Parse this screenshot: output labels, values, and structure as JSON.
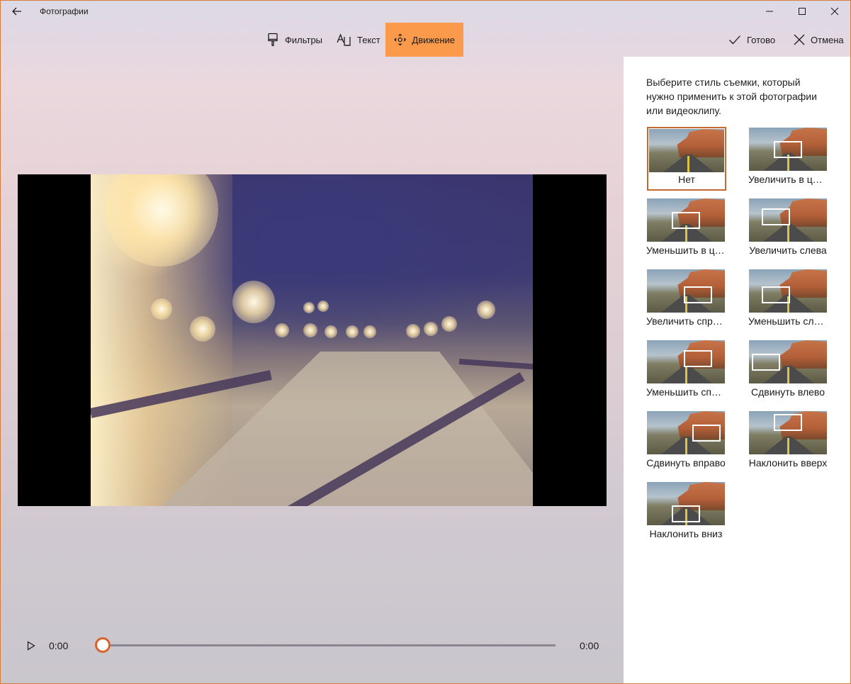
{
  "window": {
    "title": "Фотографии",
    "accent": "#d97a3a"
  },
  "toolbar": {
    "filters_label": "Фильтры",
    "text_label": "Текст",
    "motion_label": "Движение",
    "done_label": "Готово",
    "cancel_label": "Отмена",
    "active_color": "#fb9a4a"
  },
  "playback": {
    "current_time": "0:00",
    "total_time": "0:00",
    "progress": 0
  },
  "panel": {
    "description": "Выберите стиль съемки, который нужно применить к этой фотографии или видеоклипу.",
    "styles": [
      {
        "label": "Нет",
        "selected": true
      },
      {
        "label": "Увеличить в центре"
      },
      {
        "label": "Уменьшить в центре"
      },
      {
        "label": "Увеличить слева"
      },
      {
        "label": "Увеличить справа"
      },
      {
        "label": "Уменьшить слева"
      },
      {
        "label": "Уменьшить справа"
      },
      {
        "label": "Сдвинуть влево"
      },
      {
        "label": "Сдвинуть вправо"
      },
      {
        "label": "Наклонить вверх"
      },
      {
        "label": "Наклонить вниз"
      }
    ]
  }
}
